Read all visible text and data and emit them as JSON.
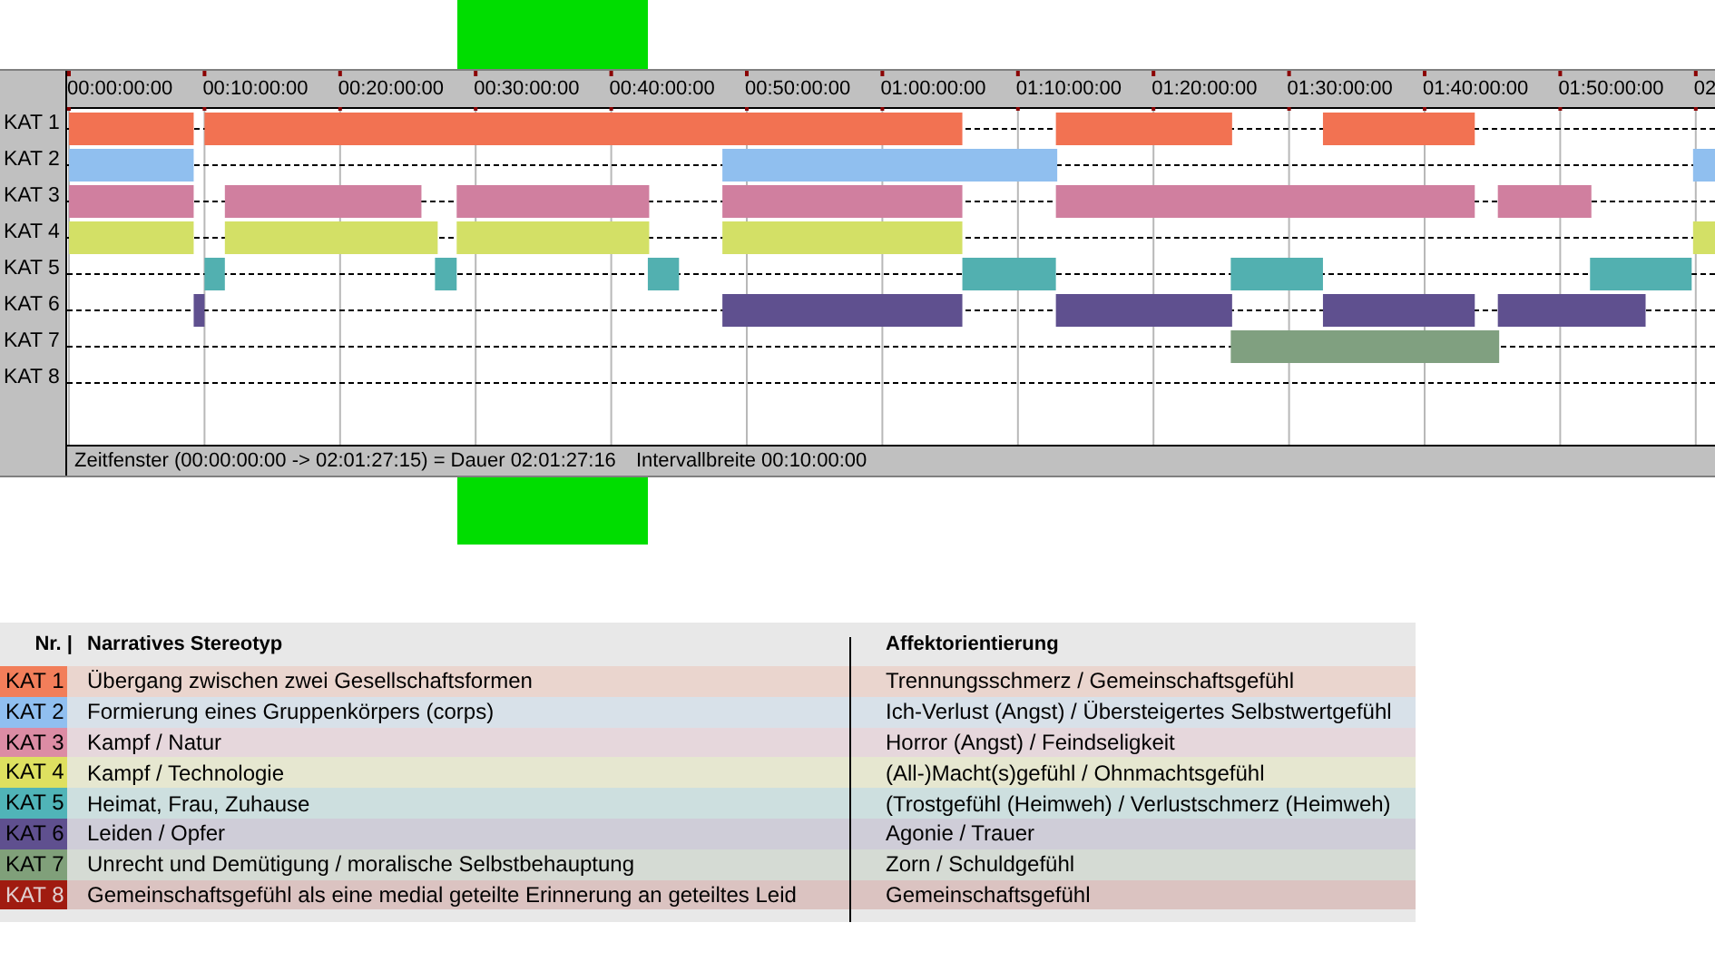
{
  "timeline": {
    "ticks": [
      "00:00:00:00",
      "00:10:00:00",
      "00:20:00:00",
      "00:30:00:00",
      "00:40:00:00",
      "00:50:00:00",
      "01:00:00:00",
      "01:10:00:00",
      "01:20:00:00",
      "01:30:00:00",
      "01:40:00:00",
      "01:50:00:00",
      "02"
    ],
    "tracks": [
      {
        "label": "KAT 1",
        "color": "#f27252"
      },
      {
        "label": "KAT 2",
        "color": "#90bfef"
      },
      {
        "label": "KAT 3",
        "color": "#d07f9f"
      },
      {
        "label": "KAT 4",
        "color": "#d3e066"
      },
      {
        "label": "KAT 5",
        "color": "#52b0b0"
      },
      {
        "label": "KAT 6",
        "color": "#5f508f"
      },
      {
        "label": "KAT 7",
        "color": "#80a080"
      },
      {
        "label": "KAT 8"
      }
    ],
    "status": {
      "window": "Zeitfenster (00:00:00:00 -> 02:01:27:15) = Dauer 02:01:27:16",
      "interval": "Intervallbreite 00:10:00:00"
    }
  },
  "legend": {
    "columns": [
      "Nr. |",
      "Narratives Stereotyp",
      "Affektorientierung"
    ],
    "rows": [
      {
        "nr": "KAT 1",
        "stereotype": "Übergang zwischen zwei Gesellschaftsformen",
        "affect": "Trennungsschmerz / Gemeinschaftsgefühl",
        "color": "#f27e5a"
      },
      {
        "nr": "KAT 2",
        "stereotype": "Formierung eines Gruppenkörpers (corps)",
        "affect": "Ich-Verlust (Angst) / Übersteigertes Selbstwertgefühl",
        "color": "#90bff0"
      },
      {
        "nr": "KAT 3",
        "stereotype": "Kampf / Natur",
        "affect": "Horror (Angst) / Feindseligkeit",
        "color": "#dc8ca4"
      },
      {
        "nr": "KAT 4",
        "stereotype": "Kampf / Technologie",
        "affect": "(All-)Macht(s)gefühl / Ohnmachtsgefühl",
        "color": "#dee060"
      },
      {
        "nr": "KAT 5",
        "stereotype": "Heimat, Frau, Zuhause",
        "affect": "(Trostgefühl (Heimweh) / Verlustschmerz (Heimweh)",
        "color": "#50b4b8"
      },
      {
        "nr": "KAT 6",
        "stereotype": "Leiden / Opfer",
        "affect": "Agonie / Trauer",
        "color": "#5f508f"
      },
      {
        "nr": "KAT 7",
        "stereotype": "Unrecht und Demütigung / moralische Selbstbehauptung",
        "affect": "Zorn / Schuldgefühl",
        "color": "#80a07a"
      },
      {
        "nr": "KAT 8",
        "stereotype": "Gemeinschaftsgefühl als eine medial geteilte Erinnerung an geteiltes Leid",
        "affect": "Gemeinschaftsgefühl",
        "color": "#a01b10"
      }
    ]
  }
}
